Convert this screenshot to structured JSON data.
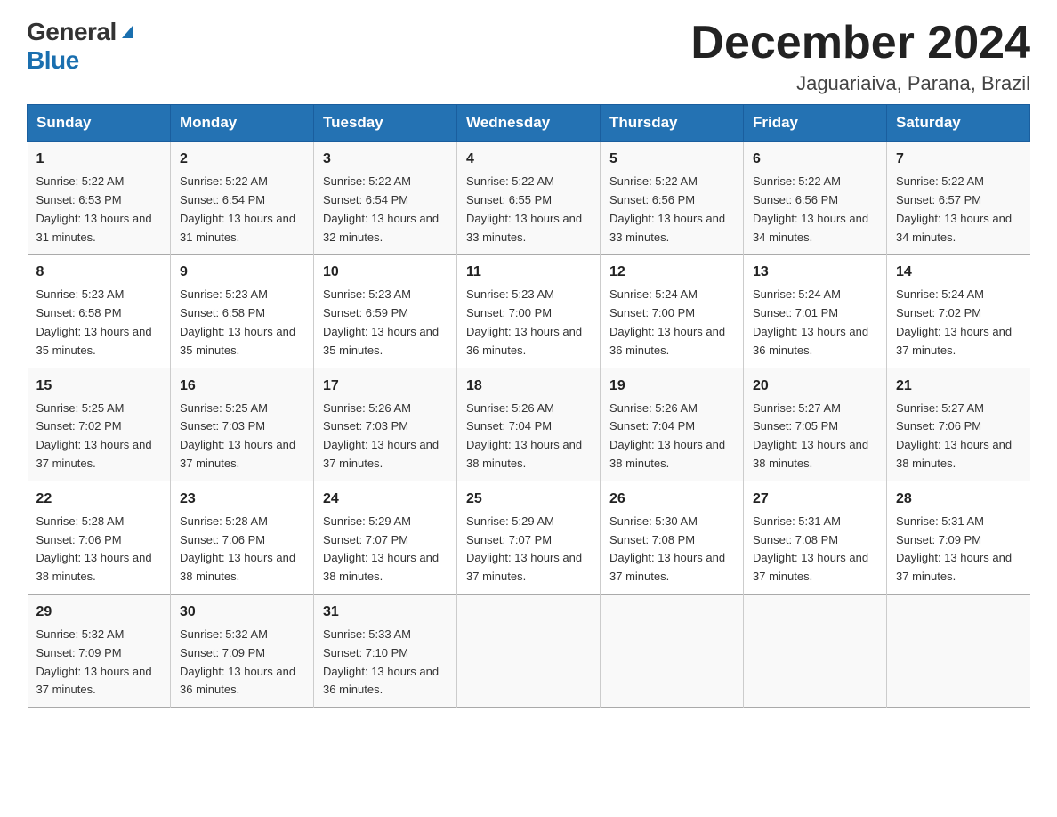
{
  "header": {
    "logo_general": "General",
    "logo_blue": "Blue",
    "month_title": "December 2024",
    "location": "Jaguariaiva, Parana, Brazil"
  },
  "weekdays": [
    "Sunday",
    "Monday",
    "Tuesday",
    "Wednesday",
    "Thursday",
    "Friday",
    "Saturday"
  ],
  "weeks": [
    [
      {
        "day": "1",
        "sunrise": "5:22 AM",
        "sunset": "6:53 PM",
        "daylight": "13 hours and 31 minutes."
      },
      {
        "day": "2",
        "sunrise": "5:22 AM",
        "sunset": "6:54 PM",
        "daylight": "13 hours and 31 minutes."
      },
      {
        "day": "3",
        "sunrise": "5:22 AM",
        "sunset": "6:54 PM",
        "daylight": "13 hours and 32 minutes."
      },
      {
        "day": "4",
        "sunrise": "5:22 AM",
        "sunset": "6:55 PM",
        "daylight": "13 hours and 33 minutes."
      },
      {
        "day": "5",
        "sunrise": "5:22 AM",
        "sunset": "6:56 PM",
        "daylight": "13 hours and 33 minutes."
      },
      {
        "day": "6",
        "sunrise": "5:22 AM",
        "sunset": "6:56 PM",
        "daylight": "13 hours and 34 minutes."
      },
      {
        "day": "7",
        "sunrise": "5:22 AM",
        "sunset": "6:57 PM",
        "daylight": "13 hours and 34 minutes."
      }
    ],
    [
      {
        "day": "8",
        "sunrise": "5:23 AM",
        "sunset": "6:58 PM",
        "daylight": "13 hours and 35 minutes."
      },
      {
        "day": "9",
        "sunrise": "5:23 AM",
        "sunset": "6:58 PM",
        "daylight": "13 hours and 35 minutes."
      },
      {
        "day": "10",
        "sunrise": "5:23 AM",
        "sunset": "6:59 PM",
        "daylight": "13 hours and 35 minutes."
      },
      {
        "day": "11",
        "sunrise": "5:23 AM",
        "sunset": "7:00 PM",
        "daylight": "13 hours and 36 minutes."
      },
      {
        "day": "12",
        "sunrise": "5:24 AM",
        "sunset": "7:00 PM",
        "daylight": "13 hours and 36 minutes."
      },
      {
        "day": "13",
        "sunrise": "5:24 AM",
        "sunset": "7:01 PM",
        "daylight": "13 hours and 36 minutes."
      },
      {
        "day": "14",
        "sunrise": "5:24 AM",
        "sunset": "7:02 PM",
        "daylight": "13 hours and 37 minutes."
      }
    ],
    [
      {
        "day": "15",
        "sunrise": "5:25 AM",
        "sunset": "7:02 PM",
        "daylight": "13 hours and 37 minutes."
      },
      {
        "day": "16",
        "sunrise": "5:25 AM",
        "sunset": "7:03 PM",
        "daylight": "13 hours and 37 minutes."
      },
      {
        "day": "17",
        "sunrise": "5:26 AM",
        "sunset": "7:03 PM",
        "daylight": "13 hours and 37 minutes."
      },
      {
        "day": "18",
        "sunrise": "5:26 AM",
        "sunset": "7:04 PM",
        "daylight": "13 hours and 38 minutes."
      },
      {
        "day": "19",
        "sunrise": "5:26 AM",
        "sunset": "7:04 PM",
        "daylight": "13 hours and 38 minutes."
      },
      {
        "day": "20",
        "sunrise": "5:27 AM",
        "sunset": "7:05 PM",
        "daylight": "13 hours and 38 minutes."
      },
      {
        "day": "21",
        "sunrise": "5:27 AM",
        "sunset": "7:06 PM",
        "daylight": "13 hours and 38 minutes."
      }
    ],
    [
      {
        "day": "22",
        "sunrise": "5:28 AM",
        "sunset": "7:06 PM",
        "daylight": "13 hours and 38 minutes."
      },
      {
        "day": "23",
        "sunrise": "5:28 AM",
        "sunset": "7:06 PM",
        "daylight": "13 hours and 38 minutes."
      },
      {
        "day": "24",
        "sunrise": "5:29 AM",
        "sunset": "7:07 PM",
        "daylight": "13 hours and 38 minutes."
      },
      {
        "day": "25",
        "sunrise": "5:29 AM",
        "sunset": "7:07 PM",
        "daylight": "13 hours and 37 minutes."
      },
      {
        "day": "26",
        "sunrise": "5:30 AM",
        "sunset": "7:08 PM",
        "daylight": "13 hours and 37 minutes."
      },
      {
        "day": "27",
        "sunrise": "5:31 AM",
        "sunset": "7:08 PM",
        "daylight": "13 hours and 37 minutes."
      },
      {
        "day": "28",
        "sunrise": "5:31 AM",
        "sunset": "7:09 PM",
        "daylight": "13 hours and 37 minutes."
      }
    ],
    [
      {
        "day": "29",
        "sunrise": "5:32 AM",
        "sunset": "7:09 PM",
        "daylight": "13 hours and 37 minutes."
      },
      {
        "day": "30",
        "sunrise": "5:32 AM",
        "sunset": "7:09 PM",
        "daylight": "13 hours and 36 minutes."
      },
      {
        "day": "31",
        "sunrise": "5:33 AM",
        "sunset": "7:10 PM",
        "daylight": "13 hours and 36 minutes."
      },
      null,
      null,
      null,
      null
    ]
  ]
}
